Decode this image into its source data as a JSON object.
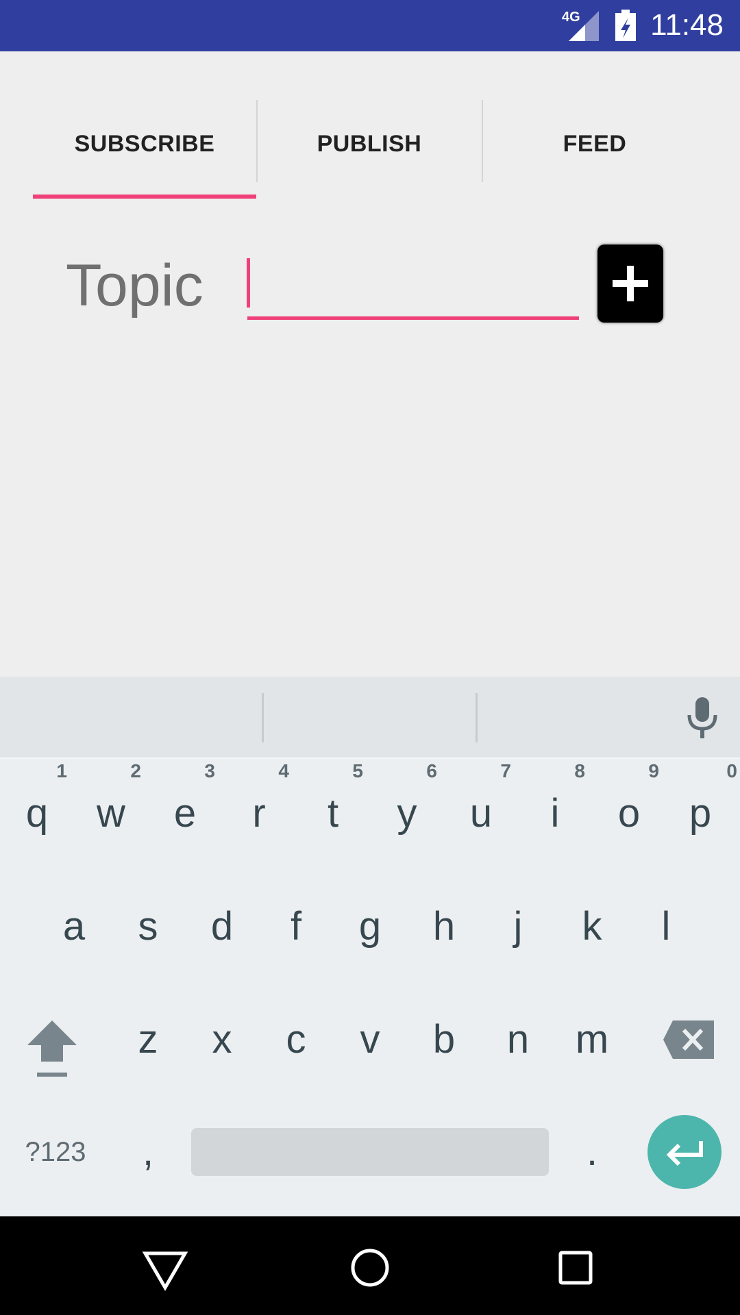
{
  "status_bar": {
    "network": "4G",
    "time": "11:48",
    "background_color": "#303f9f"
  },
  "tabs": [
    {
      "label": "SUBSCRIBE",
      "selected": true
    },
    {
      "label": "PUBLISH",
      "selected": false
    },
    {
      "label": "FEED",
      "selected": false
    }
  ],
  "accent_color": "#f0407a",
  "form": {
    "topic_label": "Topic",
    "topic_value": "",
    "add_button_icon": "plus-icon"
  },
  "keyboard": {
    "row1": [
      {
        "key": "q",
        "hint": "1"
      },
      {
        "key": "w",
        "hint": "2"
      },
      {
        "key": "e",
        "hint": "3"
      },
      {
        "key": "r",
        "hint": "4"
      },
      {
        "key": "t",
        "hint": "5"
      },
      {
        "key": "y",
        "hint": "6"
      },
      {
        "key": "u",
        "hint": "7"
      },
      {
        "key": "i",
        "hint": "8"
      },
      {
        "key": "o",
        "hint": "9"
      },
      {
        "key": "p",
        "hint": "0"
      }
    ],
    "row2": [
      "a",
      "s",
      "d",
      "f",
      "g",
      "h",
      "j",
      "k",
      "l"
    ],
    "row3": [
      "z",
      "x",
      "c",
      "v",
      "b",
      "n",
      "m"
    ],
    "symbols_label": "?123",
    "comma": ",",
    "period": ".",
    "enter_color": "#4db6ac"
  },
  "nav": {
    "back_icon": "back-triangle-icon",
    "home_icon": "home-circle-icon",
    "recents_icon": "recents-square-icon"
  }
}
